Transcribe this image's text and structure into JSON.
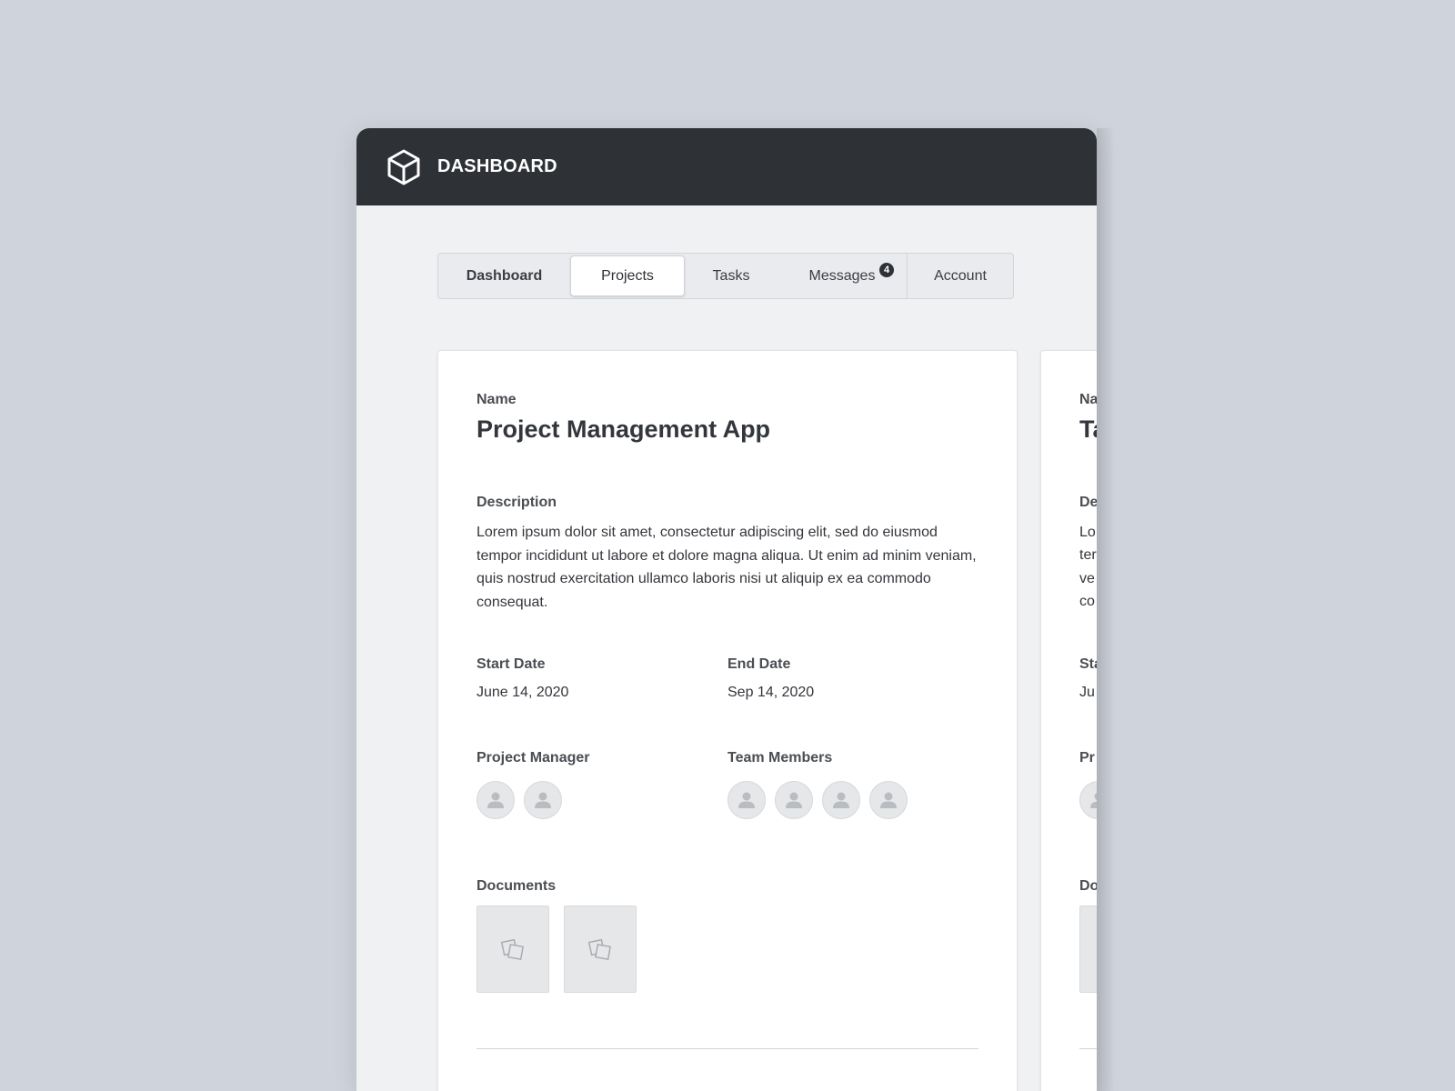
{
  "app": {
    "title": "DASHBOARD",
    "logo_icon": "cube-icon"
  },
  "tabs": [
    {
      "label": "Dashboard",
      "active": false
    },
    {
      "label": "Projects",
      "active": true
    },
    {
      "label": "Tasks",
      "active": false
    },
    {
      "label": "Messages",
      "active": false,
      "badge": "4"
    },
    {
      "label": "Account",
      "active": false
    }
  ],
  "project": {
    "name_label": "Name",
    "name": "Project Management App",
    "description_label": "Description",
    "description": "Lorem ipsum dolor sit amet, consectetur adipiscing elit, sed do eiusmod tempor incididunt ut labore et dolore magna aliqua. Ut enim ad minim veniam, quis nostrud exercitation ullamco laboris nisi ut aliquip ex ea commodo consequat.",
    "start_label": "Start Date",
    "start_date": "June 14, 2020",
    "end_label": "End Date",
    "end_date": "Sep 14, 2020",
    "manager_label": "Project Manager",
    "manager_count": 2,
    "team_label": "Team Members",
    "team_count": 4,
    "documents_label": "Documents",
    "document_count": 2
  },
  "side_card": {
    "name_label_partial": "Na",
    "name_partial": "Ta",
    "description_label_partial": "De",
    "description_lines_partial": [
      "Lo",
      "ter",
      "ve",
      "co"
    ],
    "start_label_partial": "Sta",
    "start_date_partial": "Ju",
    "manager_label_partial": "Pr",
    "documents_label_partial": "Do"
  },
  "colors": {
    "background": "#cfd3db",
    "topbar": "#2e3136",
    "window": "#f0f1f3",
    "card": "#ffffff",
    "placeholder": "#e6e7e9"
  }
}
